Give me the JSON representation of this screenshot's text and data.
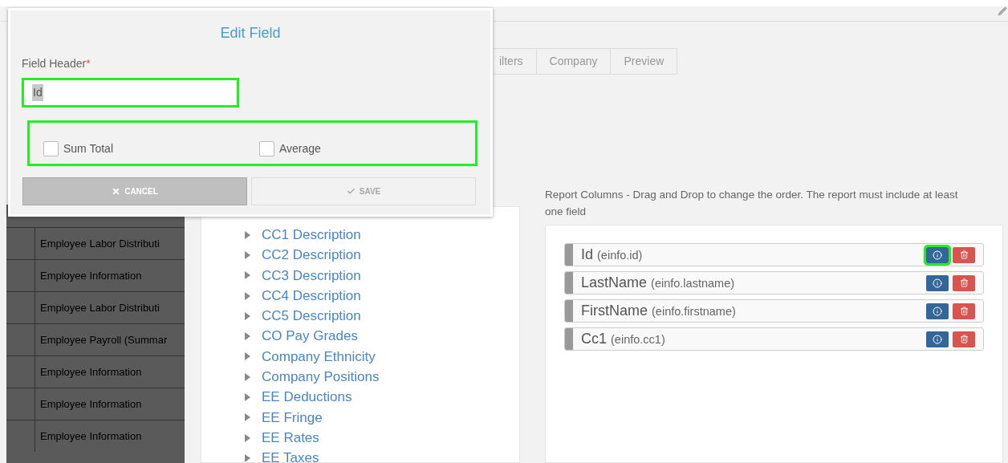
{
  "dialog": {
    "title": "Edit Field",
    "field_label": "Field Header",
    "required_mark": "*",
    "field": {
      "value": "Id",
      "highlighted": true
    },
    "options_highlighted": true,
    "options": [
      {
        "label": "Sum Total",
        "checked": false
      },
      {
        "label": "Average",
        "checked": false
      }
    ],
    "buttons": [
      {
        "label": "CANCEL",
        "kind": "cancel",
        "disabled": false
      },
      {
        "label": "SAVE",
        "kind": "save",
        "disabled": true
      }
    ]
  },
  "tabs": [
    {
      "label": "ilters",
      "selected": false
    },
    {
      "label": "Company",
      "selected": false
    },
    {
      "label": "Preview",
      "selected": false
    }
  ],
  "sidebar": {
    "rows": [
      "Employee Labor Distributi",
      "Employee Information",
      "Employee Labor Distributi",
      "Employee Payroll (Summar",
      "Employee Information",
      "Employee Information",
      "Employee Information"
    ]
  },
  "field_tree": {
    "items": [
      "CC1 Description",
      "CC2 Description",
      "CC3 Description",
      "CC4 Description",
      "CC5 Description",
      "CO Pay Grades",
      "Company Ethnicity",
      "Company Positions",
      "EE Deductions",
      "EE Fringe",
      "EE Rates",
      "EE Taxes"
    ]
  },
  "report_columns": {
    "instructions": "Report Columns - Drag and Drop to change the order. The report must include at least one field",
    "columns": [
      {
        "name": "Id",
        "source": "(einfo.id)",
        "highlighted": true
      },
      {
        "name": "LastName",
        "source": "(einfo.lastname)",
        "highlighted": false
      },
      {
        "name": "FirstName",
        "source": "(einfo.firstname)",
        "highlighted": false
      },
      {
        "name": "Cc1",
        "source": "(einfo.cc1)",
        "highlighted": false
      }
    ]
  }
}
